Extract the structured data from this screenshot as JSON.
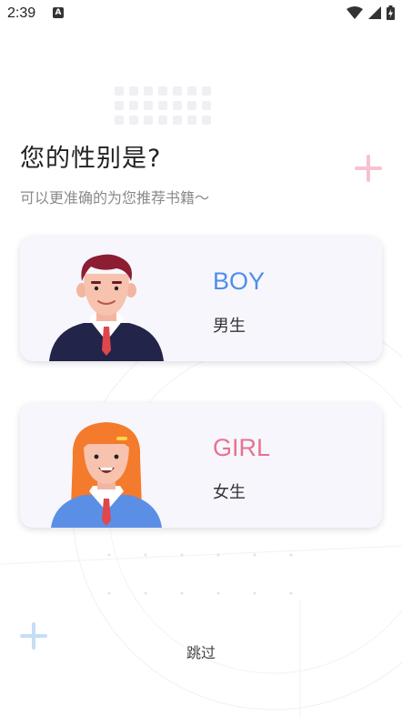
{
  "status_bar": {
    "time": "2:39",
    "app_icon_letter": "A"
  },
  "header": {
    "title": "您的性别是?",
    "subtitle": "可以更准确的为您推荐书籍～"
  },
  "options": {
    "boy": {
      "label_en": "BOY",
      "label_zh": "男生"
    },
    "girl": {
      "label_en": "GIRL",
      "label_zh": "女生"
    }
  },
  "skip_label": "跳过",
  "colors": {
    "boy_accent": "#4d8fe8",
    "girl_accent": "#e8728f",
    "plus_pink": "#f7c2d0",
    "plus_blue": "#c7ddf6",
    "card_bg": "#f7f6fc"
  },
  "icons": [
    "wifi-icon",
    "signal-icon",
    "battery-icon",
    "plus-icon",
    "boy-avatar",
    "girl-avatar"
  ]
}
